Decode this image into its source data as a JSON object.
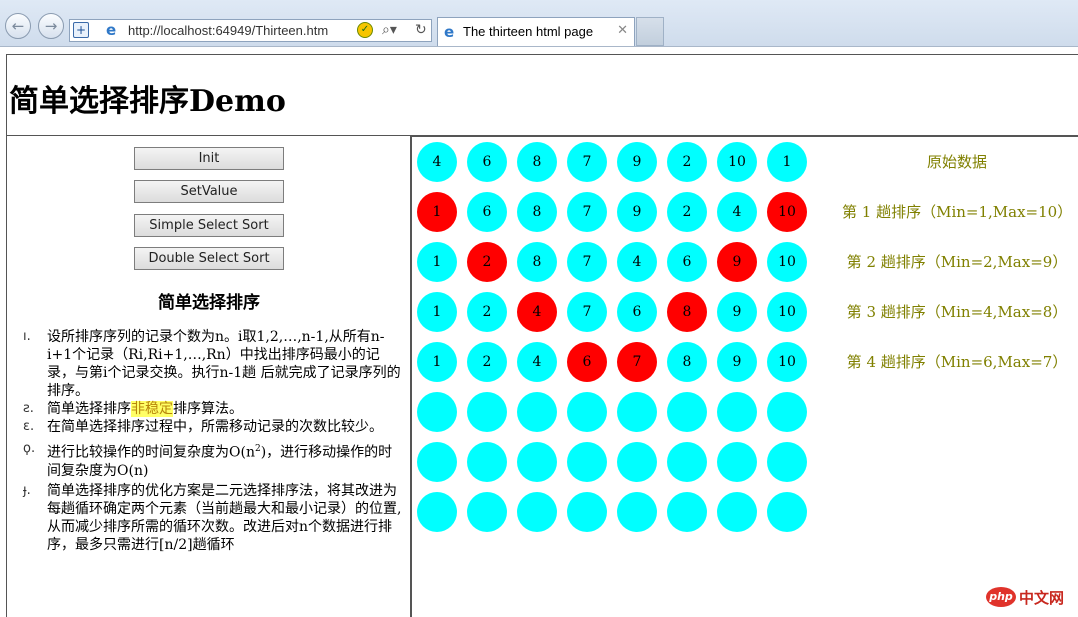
{
  "browser": {
    "url": "http://localhost:64949/Thirteen.htm",
    "url_host": "localhost",
    "tab_title": "The thirteen html page",
    "icons": [
      "back-icon",
      "forward-icon",
      "security-icon",
      "ie-icon",
      "compatibility-icon",
      "search-icon",
      "refresh-icon",
      "close-icon"
    ]
  },
  "page": {
    "title": "简单选择排序Demo",
    "buttons": {
      "init": "Init",
      "set_value": "SetValue",
      "simple_sort": "Simple Select Sort",
      "double_sort": "Double Select Sort"
    },
    "section_title": "简单选择排序",
    "notes": [
      {
        "num": "ı.",
        "text": "设所排序序列的记录个数为n。i取1,2,…,n-1,从所有n-i+1个记录（Ri,Ri+1,…,Rn）中找出排序码最小的记录，与第i个记录交换。执行n-1趟 后就完成了记录序列的排序。"
      },
      {
        "num": "ƨ.",
        "before": "简单选择排序",
        "highlight": "非稳定",
        "after": "排序算法。"
      },
      {
        "num": "ɛ.",
        "text": "在简单选择排序过程中，所需移动记录的次数比较少。"
      },
      {
        "num": "ϙ.",
        "before": "进行比较操作的时间复杂度为O(n",
        "sup": "2",
        "after": ")，进行移动操作的时间复杂度为O(n)"
      },
      {
        "num": "ɟ.",
        "text": "简单选择排序的优化方案是二元选择排序法，将其改进为每趟循环确定两个元素（当前趟最大和最小记录）的位置,从而减少排序所需的循环次数。改进后对n个数据进行排序，最多只需进行[n/2]趟循环"
      }
    ]
  },
  "colors": {
    "ball": "#00ffff",
    "ball_highlight": "#ff0000",
    "label": "#808000",
    "note_highlight": "#ffff66"
  },
  "rows": [
    {
      "label": "原始数据",
      "cells": [
        {
          "v": "4"
        },
        {
          "v": "6"
        },
        {
          "v": "8"
        },
        {
          "v": "7"
        },
        {
          "v": "9"
        },
        {
          "v": "2"
        },
        {
          "v": "10"
        },
        {
          "v": "1"
        }
      ]
    },
    {
      "label": "第 1 趟排序（Min=1,Max=10）",
      "cells": [
        {
          "v": "1",
          "red": true
        },
        {
          "v": "6"
        },
        {
          "v": "8"
        },
        {
          "v": "7"
        },
        {
          "v": "9"
        },
        {
          "v": "2"
        },
        {
          "v": "4"
        },
        {
          "v": "10",
          "red": true
        }
      ]
    },
    {
      "label": "第 2 趟排序（Min=2,Max=9）",
      "cells": [
        {
          "v": "1"
        },
        {
          "v": "2",
          "red": true
        },
        {
          "v": "8"
        },
        {
          "v": "7"
        },
        {
          "v": "4"
        },
        {
          "v": "6"
        },
        {
          "v": "9",
          "red": true
        },
        {
          "v": "10"
        }
      ]
    },
    {
      "label": "第 3 趟排序（Min=4,Max=8）",
      "cells": [
        {
          "v": "1"
        },
        {
          "v": "2"
        },
        {
          "v": "4",
          "red": true
        },
        {
          "v": "7"
        },
        {
          "v": "6"
        },
        {
          "v": "8",
          "red": true
        },
        {
          "v": "9"
        },
        {
          "v": "10"
        }
      ]
    },
    {
      "label": "第 4 趟排序（Min=6,Max=7）",
      "cells": [
        {
          "v": "1"
        },
        {
          "v": "2"
        },
        {
          "v": "4"
        },
        {
          "v": "6",
          "red": true
        },
        {
          "v": "7",
          "red": true
        },
        {
          "v": "8"
        },
        {
          "v": "9"
        },
        {
          "v": "10"
        }
      ]
    },
    {
      "label": "",
      "cells": [
        {
          "v": ""
        },
        {
          "v": ""
        },
        {
          "v": ""
        },
        {
          "v": ""
        },
        {
          "v": ""
        },
        {
          "v": ""
        },
        {
          "v": ""
        },
        {
          "v": ""
        }
      ]
    },
    {
      "label": "",
      "cells": [
        {
          "v": ""
        },
        {
          "v": ""
        },
        {
          "v": ""
        },
        {
          "v": ""
        },
        {
          "v": ""
        },
        {
          "v": ""
        },
        {
          "v": ""
        },
        {
          "v": ""
        }
      ]
    },
    {
      "label": "",
      "cells": [
        {
          "v": ""
        },
        {
          "v": ""
        },
        {
          "v": ""
        },
        {
          "v": ""
        },
        {
          "v": ""
        },
        {
          "v": ""
        },
        {
          "v": ""
        },
        {
          "v": ""
        }
      ]
    }
  ],
  "watermark": {
    "logo": "php",
    "text": "中文网"
  }
}
